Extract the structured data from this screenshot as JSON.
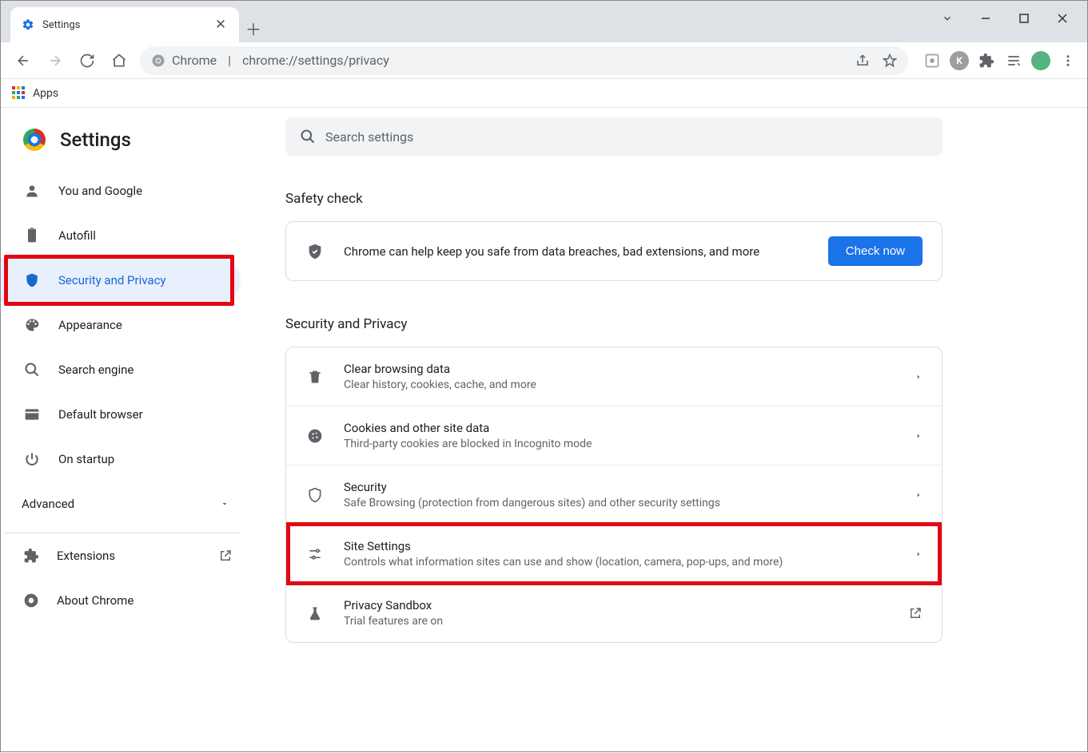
{
  "tab": {
    "title": "Settings"
  },
  "url": {
    "prefix": "Chrome",
    "path": "chrome://settings/privacy"
  },
  "bookmark": {
    "apps": "Apps"
  },
  "brand": {
    "title": "Settings"
  },
  "search_placeholder": "Search settings",
  "sidebar": {
    "items": [
      {
        "label": "You and Google"
      },
      {
        "label": "Autofill"
      },
      {
        "label": "Security and Privacy"
      },
      {
        "label": "Appearance"
      },
      {
        "label": "Search engine"
      },
      {
        "label": "Default browser"
      },
      {
        "label": "On startup"
      }
    ],
    "advanced": "Advanced",
    "extensions": "Extensions",
    "about": "About Chrome"
  },
  "safety": {
    "heading": "Safety check",
    "text": "Chrome can help keep you safe from data breaches, bad extensions, and more",
    "button": "Check now"
  },
  "privacy": {
    "heading": "Security and Privacy",
    "rows": [
      {
        "title": "Clear browsing data",
        "sub": "Clear history, cookies, cache, and more"
      },
      {
        "title": "Cookies and other site data",
        "sub": "Third-party cookies are blocked in Incognito mode"
      },
      {
        "title": "Security",
        "sub": "Safe Browsing (protection from dangerous sites) and other security settings"
      },
      {
        "title": "Site Settings",
        "sub": "Controls what information sites can use and show (location, camera, pop-ups, and more)"
      },
      {
        "title": "Privacy Sandbox",
        "sub": "Trial features are on"
      }
    ]
  },
  "ext_k": "K"
}
